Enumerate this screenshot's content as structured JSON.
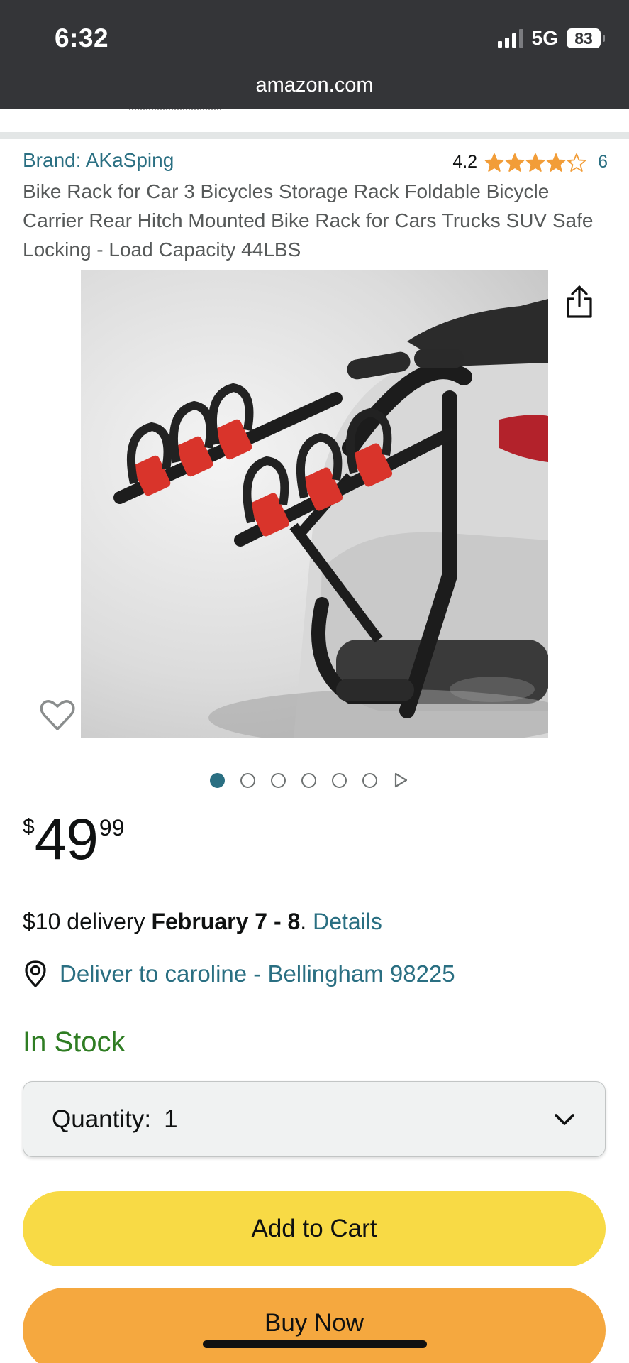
{
  "status_bar": {
    "time": "6:32",
    "network": "5G",
    "battery": "83"
  },
  "browser": {
    "url": "amazon.com"
  },
  "product": {
    "brand": "Brand: AKaSping",
    "rating_value": "4.2",
    "rating_stars": 4.2,
    "rating_count": "6",
    "title": "Bike Rack for Car 3 Bicycles Storage Rack Foldable Bicycle Carrier Rear Hitch Mounted Bike Rack for Cars Trucks SUV Safe Locking - Load Capacity 44LBS",
    "image_alt": "Bike rack mounted on rear hitch of a white SUV",
    "image_count": 6,
    "active_image": 1
  },
  "price": {
    "symbol": "$",
    "whole": "49",
    "fraction": "99"
  },
  "delivery": {
    "prefix": "$10 delivery ",
    "date": "February 7 - 8",
    "suffix": ". ",
    "details_link": "Details"
  },
  "location": {
    "text": "Deliver to caroline - Bellingham 98225"
  },
  "stock": {
    "status": "In Stock"
  },
  "quantity": {
    "label": "Quantity:",
    "value": "1"
  },
  "buttons": {
    "add_to_cart": "Add to Cart",
    "buy_now": "Buy Now"
  },
  "icons": {
    "share": "share-icon",
    "wishlist": "heart-icon",
    "location": "location-pin-icon",
    "dropdown": "chevron-down-icon",
    "carousel_next": "play-triangle-icon"
  },
  "colors": {
    "link": "#2a6f82",
    "in_stock": "#2f7d23",
    "star": "#f29d38",
    "add_to_cart": "#f8da45",
    "buy_now": "#f5a83f",
    "chrome": "#343538"
  }
}
